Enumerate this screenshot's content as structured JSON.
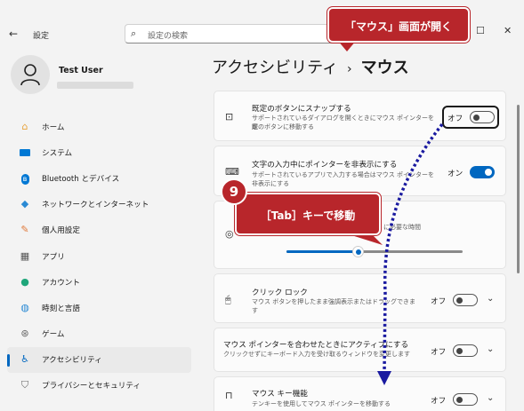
{
  "app": {
    "title": "設定",
    "back_icon": "back-arrow-icon"
  },
  "search": {
    "placeholder": "設定の検索"
  },
  "user": {
    "name": "Test User"
  },
  "nav": [
    {
      "label": "ホーム",
      "icon": "home-icon",
      "color": "#e8a33c"
    },
    {
      "label": "システム",
      "icon": "system-icon",
      "color": "#0078d4"
    },
    {
      "label": "Bluetooth とデバイス",
      "icon": "bluetooth-icon",
      "color": "#0078d4"
    },
    {
      "label": "ネットワークとインターネット",
      "icon": "network-icon",
      "color": "#2a8ad4"
    },
    {
      "label": "個人用設定",
      "icon": "brush-icon",
      "color": "#e07a3c"
    },
    {
      "label": "アプリ",
      "icon": "apps-icon",
      "color": "#555"
    },
    {
      "label": "アカウント",
      "icon": "account-icon",
      "color": "#1fa67a"
    },
    {
      "label": "時刻と言語",
      "icon": "globe-icon",
      "color": "#2a8ad4"
    },
    {
      "label": "ゲーム",
      "icon": "game-icon",
      "color": "#666"
    },
    {
      "label": "アクセシビリティ",
      "icon": "accessibility-icon",
      "color": "#0067c0",
      "active": true
    },
    {
      "label": "プライバシーとセキュリティ",
      "icon": "shield-icon",
      "color": "#666"
    }
  ],
  "breadcrumb": {
    "parent": "アクセシビリティ",
    "separator": "›",
    "current": "マウス"
  },
  "settings": {
    "snap": {
      "title": "既定のボタンにスナップする",
      "desc1": "サポートされているダイアログを開くときにマウス ポインターを既",
      "desc2": "定のボタンに移動する",
      "state": "オフ"
    },
    "hide_pointer": {
      "title": "文字の入力中にポインターを非表示にする",
      "desc1": "サポートされているアプリで入力する場合はマウス ポインターを",
      "desc2": "非表示にする",
      "state": "オン"
    },
    "click_time": {
      "label_tail": "に必要な時間"
    },
    "click_lock": {
      "title": "クリック ロック",
      "desc1": "マウス ボタンを押したまま強調表示またはドラッグできま",
      "desc2": "す",
      "state": "オフ"
    },
    "activate_hover": {
      "title": "マウス ポインターを合わせたときにアクティブにする",
      "desc1": "クリックせずにキーボード入力を受け取るウィンドウを変更します",
      "state": "オフ"
    },
    "mouse_keys": {
      "title": "マウス キー機能",
      "desc1": "テンキーを使用してマウス ポインターを移動する",
      "state": "オフ"
    }
  },
  "annotations": {
    "top_callout": "「マウス」画面が開く",
    "step_number": "9",
    "mid_callout": "［Tab］キーで移動",
    "accent": "#b8262b"
  }
}
